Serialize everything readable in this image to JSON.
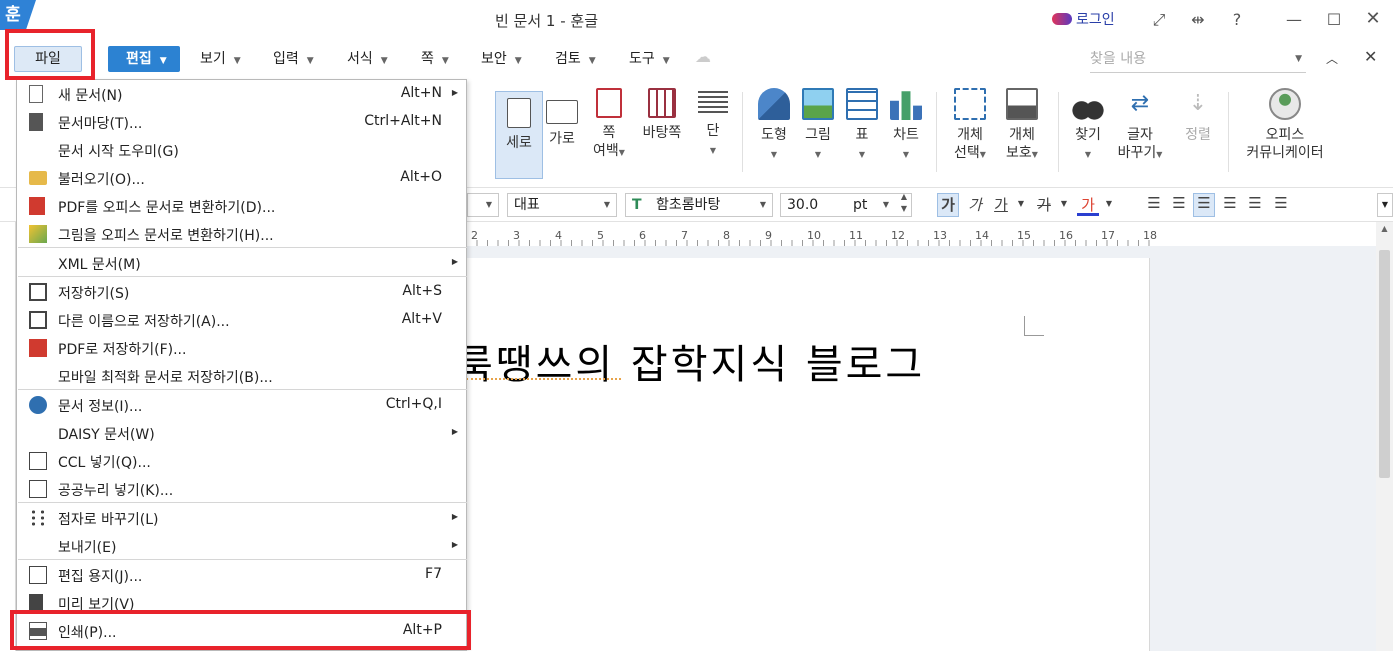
{
  "titlebar": {
    "app_logo": "훈",
    "title": "빈 문서 1 - 훈글",
    "login": "로그인",
    "help": "?"
  },
  "menubar": {
    "file": "파일",
    "edit": "편집",
    "items": [
      "보기",
      "입력",
      "서식",
      "쪽",
      "보안",
      "검토",
      "도구"
    ],
    "search_placeholder": "찾을 내용"
  },
  "ribbon": {
    "page_buttons": [
      {
        "label": "세로"
      },
      {
        "label": "가로"
      },
      {
        "label": "쪽",
        "label2": "여백"
      },
      {
        "label": "바탕쪽"
      },
      {
        "label": "단"
      }
    ],
    "insert_buttons": [
      {
        "label": "도형"
      },
      {
        "label": "그림"
      },
      {
        "label": "표"
      },
      {
        "label": "차트"
      }
    ],
    "object_buttons": [
      {
        "label": "개체",
        "label2": "선택"
      },
      {
        "label": "개체",
        "label2": "보호"
      }
    ],
    "find_buttons": [
      {
        "label": "찾기"
      },
      {
        "label": "글자",
        "label2": "바꾸기"
      },
      {
        "label": "정렬"
      }
    ],
    "community": {
      "label": "오피스",
      "label2": "커뮤니케이터"
    }
  },
  "formatbar": {
    "style": "대표",
    "font": "함초롬바탕",
    "size": "30.0",
    "unit": "pt",
    "bold": "가",
    "italic": "가",
    "underline": "가",
    "strike": "가",
    "color": "가"
  },
  "ruler": {
    "numbers": [
      "2",
      "3",
      "4",
      "5",
      "6",
      "7",
      "8",
      "9",
      "10",
      "11",
      "12",
      "13",
      "14",
      "15",
      "16",
      "17",
      "18"
    ]
  },
  "document": {
    "text": "룩땡쓰의 잡학지식 블로그"
  },
  "file_menu": {
    "items": [
      {
        "label": "새 문서(N)",
        "shortcut": "Alt+N",
        "submenu": true,
        "icon": "new-document-icon"
      },
      {
        "label": "문서마당(T)...",
        "shortcut": "Ctrl+Alt+N",
        "icon": "template-icon"
      },
      {
        "label": "문서 시작 도우미(G)",
        "shortcut": "",
        "icon": ""
      },
      {
        "label": "불러오기(O)...",
        "shortcut": "Alt+O",
        "icon": "open-folder-icon"
      },
      {
        "label": "PDF를 오피스 문서로 변환하기(D)...",
        "shortcut": "",
        "icon": "pdf-convert-icon"
      },
      {
        "label": "그림을 오피스 문서로 변환하기(H)...",
        "shortcut": "",
        "icon": "image-convert-icon"
      },
      {
        "label": "XML 문서(M)",
        "shortcut": "",
        "submenu": true,
        "icon": ""
      },
      {
        "label": "저장하기(S)",
        "shortcut": "Alt+S",
        "icon": "save-icon"
      },
      {
        "label": "다른 이름으로 저장하기(A)...",
        "shortcut": "Alt+V",
        "icon": "save-as-icon"
      },
      {
        "label": "PDF로 저장하기(F)...",
        "shortcut": "",
        "icon": "save-pdf-icon"
      },
      {
        "label": "모바일 최적화 문서로 저장하기(B)...",
        "shortcut": "",
        "icon": ""
      },
      {
        "label": "문서 정보(I)...",
        "shortcut": "Ctrl+Q,I",
        "icon": "info-icon"
      },
      {
        "label": "DAISY 문서(W)",
        "shortcut": "",
        "submenu": true,
        "icon": ""
      },
      {
        "label": "CCL 넣기(Q)...",
        "shortcut": "",
        "icon": "ccl-icon"
      },
      {
        "label": "공공누리 넣기(K)...",
        "shortcut": "",
        "icon": "kogl-icon"
      },
      {
        "label": "점자로 바꾸기(L)",
        "shortcut": "",
        "submenu": true,
        "icon": "braille-icon"
      },
      {
        "label": "보내기(E)",
        "shortcut": "",
        "submenu": true,
        "icon": ""
      },
      {
        "label": "편집 용지(J)...",
        "shortcut": "F7",
        "icon": "page-setup-icon"
      },
      {
        "label": "미리 보기(V)",
        "shortcut": "",
        "icon": "preview-icon"
      },
      {
        "label": "인쇄(P)...",
        "shortcut": "Alt+P",
        "icon": "print-icon"
      }
    ]
  },
  "colors": {
    "accent": "#2c82d2",
    "highlight_box": "#e8232b",
    "menu_selected": "#dde9f6"
  }
}
